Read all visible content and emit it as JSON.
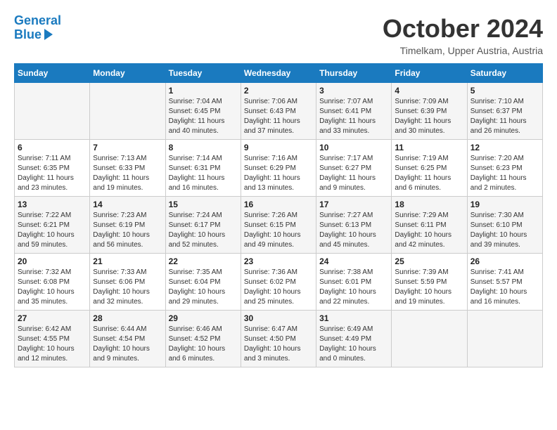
{
  "header": {
    "logo_line1": "General",
    "logo_line2": "Blue",
    "month": "October 2024",
    "location": "Timelkam, Upper Austria, Austria"
  },
  "days_of_week": [
    "Sunday",
    "Monday",
    "Tuesday",
    "Wednesday",
    "Thursday",
    "Friday",
    "Saturday"
  ],
  "weeks": [
    [
      {
        "day": "",
        "info": ""
      },
      {
        "day": "",
        "info": ""
      },
      {
        "day": "1",
        "info": "Sunrise: 7:04 AM\nSunset: 6:45 PM\nDaylight: 11 hours and 40 minutes."
      },
      {
        "day": "2",
        "info": "Sunrise: 7:06 AM\nSunset: 6:43 PM\nDaylight: 11 hours and 37 minutes."
      },
      {
        "day": "3",
        "info": "Sunrise: 7:07 AM\nSunset: 6:41 PM\nDaylight: 11 hours and 33 minutes."
      },
      {
        "day": "4",
        "info": "Sunrise: 7:09 AM\nSunset: 6:39 PM\nDaylight: 11 hours and 30 minutes."
      },
      {
        "day": "5",
        "info": "Sunrise: 7:10 AM\nSunset: 6:37 PM\nDaylight: 11 hours and 26 minutes."
      }
    ],
    [
      {
        "day": "6",
        "info": "Sunrise: 7:11 AM\nSunset: 6:35 PM\nDaylight: 11 hours and 23 minutes."
      },
      {
        "day": "7",
        "info": "Sunrise: 7:13 AM\nSunset: 6:33 PM\nDaylight: 11 hours and 19 minutes."
      },
      {
        "day": "8",
        "info": "Sunrise: 7:14 AM\nSunset: 6:31 PM\nDaylight: 11 hours and 16 minutes."
      },
      {
        "day": "9",
        "info": "Sunrise: 7:16 AM\nSunset: 6:29 PM\nDaylight: 11 hours and 13 minutes."
      },
      {
        "day": "10",
        "info": "Sunrise: 7:17 AM\nSunset: 6:27 PM\nDaylight: 11 hours and 9 minutes."
      },
      {
        "day": "11",
        "info": "Sunrise: 7:19 AM\nSunset: 6:25 PM\nDaylight: 11 hours and 6 minutes."
      },
      {
        "day": "12",
        "info": "Sunrise: 7:20 AM\nSunset: 6:23 PM\nDaylight: 11 hours and 2 minutes."
      }
    ],
    [
      {
        "day": "13",
        "info": "Sunrise: 7:22 AM\nSunset: 6:21 PM\nDaylight: 10 hours and 59 minutes."
      },
      {
        "day": "14",
        "info": "Sunrise: 7:23 AM\nSunset: 6:19 PM\nDaylight: 10 hours and 56 minutes."
      },
      {
        "day": "15",
        "info": "Sunrise: 7:24 AM\nSunset: 6:17 PM\nDaylight: 10 hours and 52 minutes."
      },
      {
        "day": "16",
        "info": "Sunrise: 7:26 AM\nSunset: 6:15 PM\nDaylight: 10 hours and 49 minutes."
      },
      {
        "day": "17",
        "info": "Sunrise: 7:27 AM\nSunset: 6:13 PM\nDaylight: 10 hours and 45 minutes."
      },
      {
        "day": "18",
        "info": "Sunrise: 7:29 AM\nSunset: 6:11 PM\nDaylight: 10 hours and 42 minutes."
      },
      {
        "day": "19",
        "info": "Sunrise: 7:30 AM\nSunset: 6:10 PM\nDaylight: 10 hours and 39 minutes."
      }
    ],
    [
      {
        "day": "20",
        "info": "Sunrise: 7:32 AM\nSunset: 6:08 PM\nDaylight: 10 hours and 35 minutes."
      },
      {
        "day": "21",
        "info": "Sunrise: 7:33 AM\nSunset: 6:06 PM\nDaylight: 10 hours and 32 minutes."
      },
      {
        "day": "22",
        "info": "Sunrise: 7:35 AM\nSunset: 6:04 PM\nDaylight: 10 hours and 29 minutes."
      },
      {
        "day": "23",
        "info": "Sunrise: 7:36 AM\nSunset: 6:02 PM\nDaylight: 10 hours and 25 minutes."
      },
      {
        "day": "24",
        "info": "Sunrise: 7:38 AM\nSunset: 6:01 PM\nDaylight: 10 hours and 22 minutes."
      },
      {
        "day": "25",
        "info": "Sunrise: 7:39 AM\nSunset: 5:59 PM\nDaylight: 10 hours and 19 minutes."
      },
      {
        "day": "26",
        "info": "Sunrise: 7:41 AM\nSunset: 5:57 PM\nDaylight: 10 hours and 16 minutes."
      }
    ],
    [
      {
        "day": "27",
        "info": "Sunrise: 6:42 AM\nSunset: 4:55 PM\nDaylight: 10 hours and 12 minutes."
      },
      {
        "day": "28",
        "info": "Sunrise: 6:44 AM\nSunset: 4:54 PM\nDaylight: 10 hours and 9 minutes."
      },
      {
        "day": "29",
        "info": "Sunrise: 6:46 AM\nSunset: 4:52 PM\nDaylight: 10 hours and 6 minutes."
      },
      {
        "day": "30",
        "info": "Sunrise: 6:47 AM\nSunset: 4:50 PM\nDaylight: 10 hours and 3 minutes."
      },
      {
        "day": "31",
        "info": "Sunrise: 6:49 AM\nSunset: 4:49 PM\nDaylight: 10 hours and 0 minutes."
      },
      {
        "day": "",
        "info": ""
      },
      {
        "day": "",
        "info": ""
      }
    ]
  ]
}
